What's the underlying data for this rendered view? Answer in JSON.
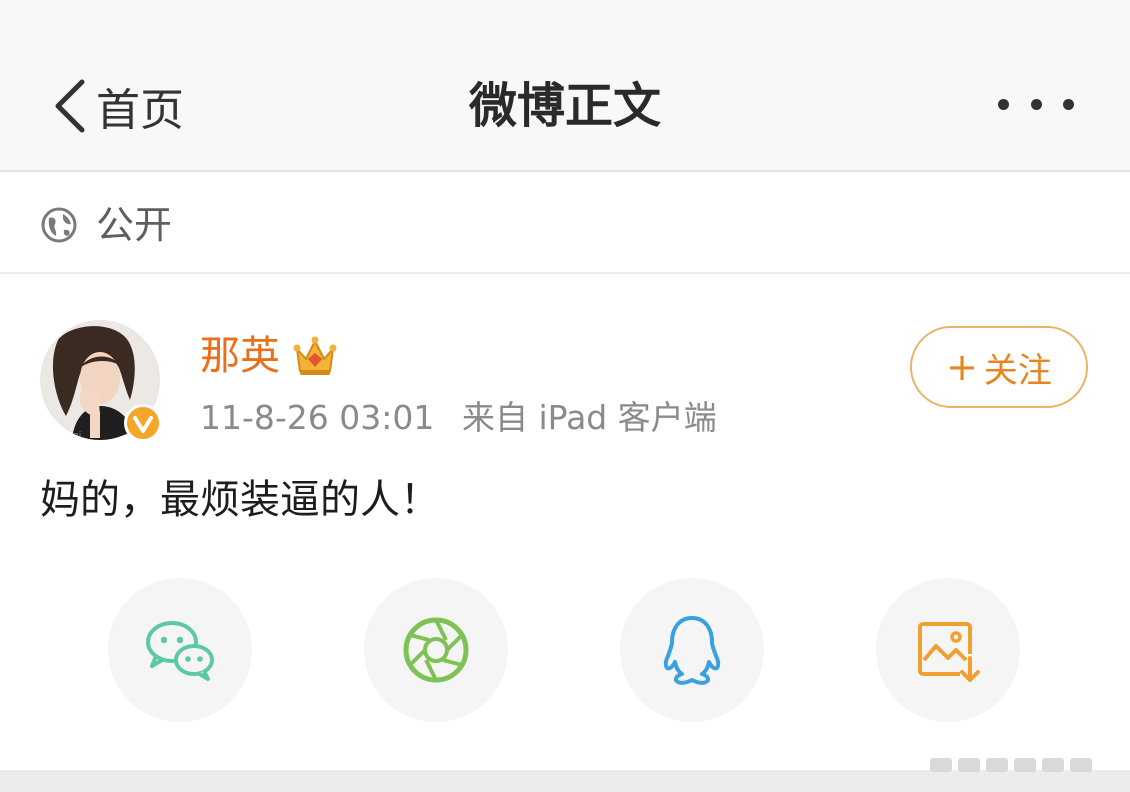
{
  "nav": {
    "back_label": "首页",
    "title": "微博正文",
    "more_icon": "more-dots-icon"
  },
  "visibility": {
    "icon": "globe-icon",
    "label": "公开"
  },
  "post": {
    "author": {
      "name": "那英",
      "avatar": "avatar",
      "badges": [
        "crown-icon",
        "verified-v-icon"
      ]
    },
    "time": "11-8-26 03:01",
    "source": "来自 iPad 客户端",
    "follow_label": "关注",
    "follow_plus": "+",
    "text": "妈的，最烦装逼的人！"
  },
  "share": [
    {
      "name": "wechat",
      "icon": "wechat-icon"
    },
    {
      "name": "moments",
      "icon": "moments-icon"
    },
    {
      "name": "qq",
      "icon": "qq-icon"
    },
    {
      "name": "save-image",
      "icon": "save-image-icon"
    }
  ],
  "colors": {
    "accent": "#e8701a",
    "follow_border": "#e9b46a",
    "wechat": "#5ccaa0",
    "moments": "#7ec255",
    "qq": "#3aa0e0",
    "save_image": "#f0a030"
  }
}
